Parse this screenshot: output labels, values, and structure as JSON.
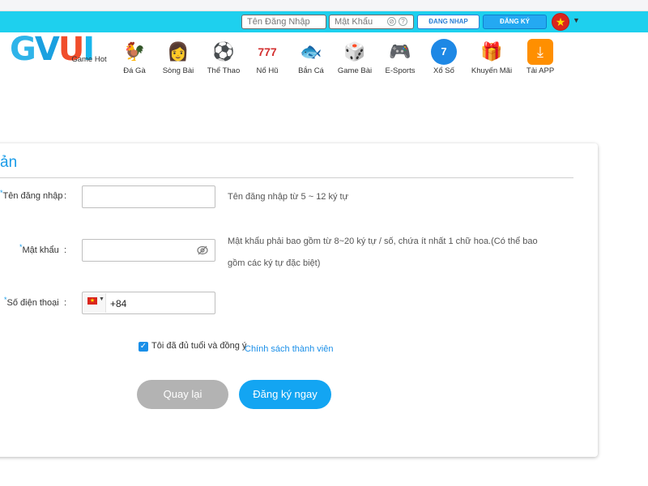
{
  "topbar": {
    "username_placeholder": "Tên Đăng Nhập",
    "password_placeholder": "Mật Khẩu",
    "login_button": "ĐANG NHAP",
    "register_button": "ĐĂNG KÝ",
    "language_flag": "vietnam-flag-icon",
    "background_color": "#1ed0ee"
  },
  "logo": {
    "text": "GVUI"
  },
  "nav": {
    "items": [
      {
        "label": "Game Hot",
        "icon": "game-hot-icon"
      },
      {
        "label": "Đá Gà",
        "icon": "rooster-icon"
      },
      {
        "label": "Sòng Bài",
        "icon": "casino-dealer-icon"
      },
      {
        "label": "Thể Thao",
        "icon": "soccer-ball-icon"
      },
      {
        "label": "Nổ Hũ",
        "icon": "slot-machine-icon"
      },
      {
        "label": "Bắn Cá",
        "icon": "fish-shooting-icon"
      },
      {
        "label": "Game Bài",
        "icon": "dice-cards-icon"
      },
      {
        "label": "E-Sports",
        "icon": "gamepad-icon"
      },
      {
        "label": "Xổ Số",
        "icon": "lottery-ball-icon"
      },
      {
        "label": "Khuyến Mãi",
        "icon": "gift-box-icon"
      },
      {
        "label": "Tải APP",
        "icon": "download-icon"
      }
    ]
  },
  "form": {
    "title": "ản",
    "username": {
      "label": "Tên đăng nhập",
      "colon": ":",
      "value": "",
      "hint": "Tên đăng nhập từ 5 ~ 12 ký tự"
    },
    "password": {
      "label": "Mật khẩu",
      "colon": ":",
      "value": "",
      "hint_line1": "Mật khẩu phải bao gồm từ 8~20 ký tự / số, chứa ít nhất 1 chữ hoa.(Có thể bao",
      "hint_line2": "gồm các ký tự đặc biệt)"
    },
    "phone": {
      "label": "Số điện thoại",
      "colon": ":",
      "country_code": "+84",
      "value": ""
    },
    "agree_text": "Tôi đã đủ tuổi và đồng ý",
    "policy_link": "Chính sách thành viên",
    "agree_checked": true,
    "back_button": "Quay lại",
    "submit_button": "Đăng ký ngay",
    "accent_color": "#1a9ce8"
  }
}
